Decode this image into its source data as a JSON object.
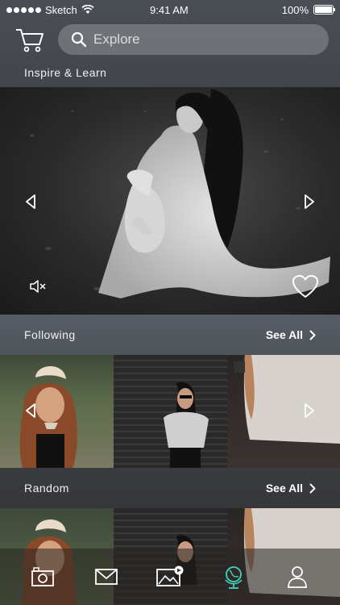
{
  "status": {
    "carrier": "Sketch",
    "time": "9:41 AM",
    "battery": "100%"
  },
  "search": {
    "placeholder": "Explore"
  },
  "sections": {
    "inspire": {
      "label": "Inspire & Learn"
    },
    "following": {
      "label": "Following",
      "see_all": "See All"
    },
    "random": {
      "label": "Random",
      "see_all": "See All"
    }
  },
  "hero": {
    "muted": true,
    "liked": false
  },
  "tabbar": {
    "active_tab": "explore",
    "active_color": "#3fd6c0",
    "icons": [
      "camera-icon",
      "mail-icon",
      "gallery-icon",
      "globe-icon",
      "profile-icon"
    ]
  }
}
